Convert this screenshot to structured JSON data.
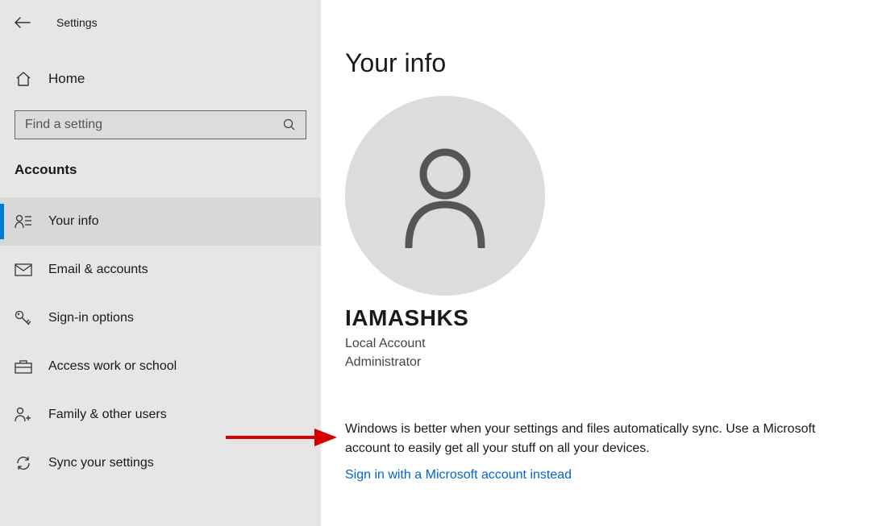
{
  "header": {
    "title": "Settings"
  },
  "home": {
    "label": "Home"
  },
  "search": {
    "placeholder": "Find a setting"
  },
  "category": {
    "heading": "Accounts"
  },
  "sidebar": {
    "items": [
      {
        "label": "Your info",
        "icon": "user-card-icon",
        "active": true
      },
      {
        "label": "Email & accounts",
        "icon": "email-icon",
        "active": false
      },
      {
        "label": "Sign-in options",
        "icon": "key-icon",
        "active": false
      },
      {
        "label": "Access work or school",
        "icon": "briefcase-icon",
        "active": false
      },
      {
        "label": "Family & other users",
        "icon": "users-add-icon",
        "active": false
      },
      {
        "label": "Sync your settings",
        "icon": "sync-icon",
        "active": false
      }
    ]
  },
  "main": {
    "page_title": "Your info",
    "username": "IAMASHKS",
    "account_type": "Local Account",
    "account_role": "Administrator",
    "sync_text": "Windows is better when your settings and files automatically sync. Use a Microsoft account to easily get all your stuff on all your devices.",
    "signin_link": "Sign in with a Microsoft account instead"
  }
}
